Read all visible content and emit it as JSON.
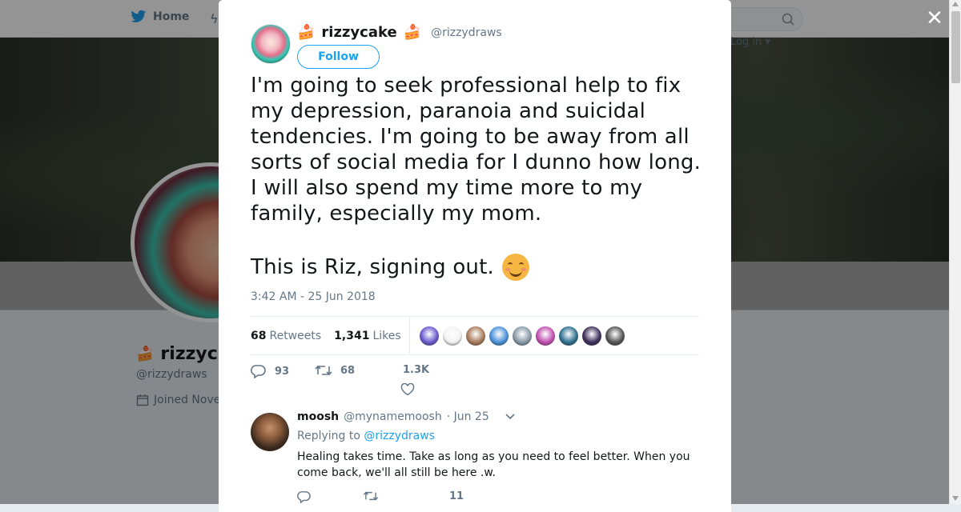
{
  "nav": {
    "home_label": "Home",
    "login_label": "Log in"
  },
  "background_profile": {
    "name": "rizzyc",
    "handle": "@rizzydraws",
    "joined": "Joined Nove"
  },
  "modal": {
    "close_glyph": "✕",
    "tweet": {
      "author_name": "rizzycake",
      "author_emoji": "🍰",
      "author_handle": "@rizzydraws",
      "follow_label": "Follow",
      "text_paragraph_1": "I'm going to seek professional help to fix my depression, paranoia and suicidal tendencies. I'm going to be away from all sorts of social media for I dunno how long. I will also spend my time more to my family, especially my mom.",
      "text_paragraph_2": "This is Riz, signing out.",
      "timestamp": "3:42 AM - 25 Jun 2018",
      "retweets_count": "68",
      "retweets_label": "Retweets",
      "likes_count": "1,341",
      "likes_label": "Likes",
      "likers": [
        {
          "color": "#6a5acd"
        },
        {
          "color": "#f2f2f2"
        },
        {
          "color": "#a87b5b"
        },
        {
          "color": "#4a90d9"
        },
        {
          "color": "#8899a6"
        },
        {
          "color": "#c04fb0"
        },
        {
          "color": "#2f6f8f"
        },
        {
          "color": "#3d2f5a"
        },
        {
          "color": "#555555"
        }
      ],
      "actions": {
        "reply_count": "93",
        "retweet_count": "68",
        "like_count": "1.3K"
      }
    },
    "reply": {
      "name": "moosh",
      "handle": "@mynamemoosh",
      "date": "· Jun 25",
      "replying_prefix": "Replying to",
      "replying_handle": "@rizzydraws",
      "text": "Healing takes time. Take as long as you need to feel better. When you come back, we'll all still be here .w.",
      "actions": {
        "like_count": "11"
      }
    }
  },
  "colors": {
    "brand_blue": "#1da1f2",
    "text_secondary": "#657786"
  }
}
